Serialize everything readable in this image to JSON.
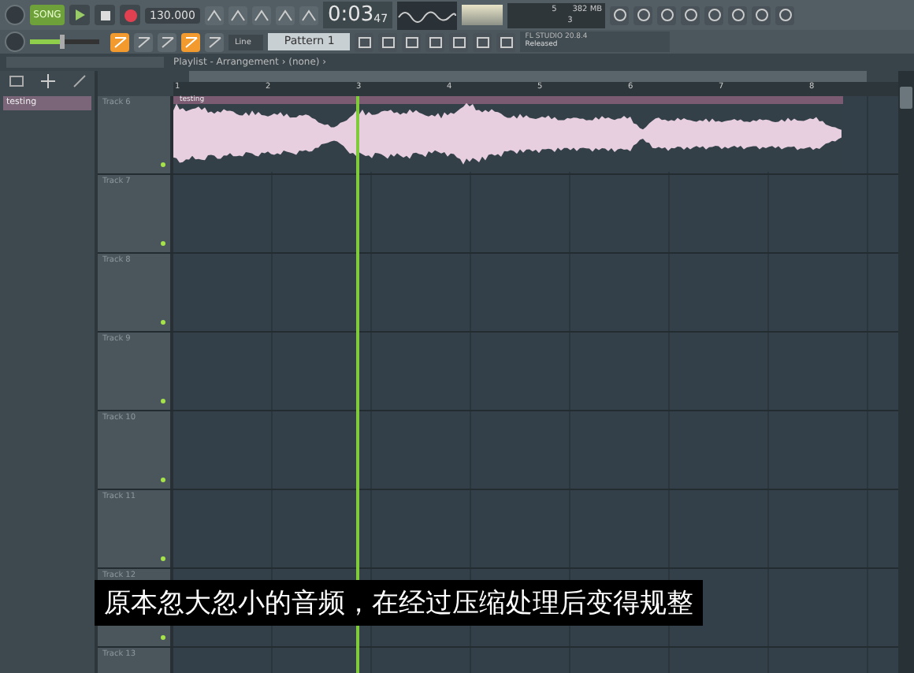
{
  "transport": {
    "mode": "SONG",
    "tempo": "130.000",
    "time": "0:03",
    "time_sub": "47"
  },
  "master_volume": {
    "level": 0.45
  },
  "snap": "Line",
  "pattern": "Pattern 1",
  "monitor": {
    "cpu": "5",
    "memory": "382 MB",
    "polyphony": "3"
  },
  "hint": {
    "title": "FL STUDIO 20.8.4",
    "text": "Released"
  },
  "tool_buttons": [
    {
      "selected": true
    },
    {
      "selected": false
    },
    {
      "selected": false
    },
    {
      "selected": true
    },
    {
      "selected": false
    }
  ],
  "playlist": {
    "title": "Playlist - Arrangement › (none) ›",
    "ruler": [
      "1",
      "2",
      "3",
      "4",
      "5",
      "6",
      "7",
      "8"
    ],
    "tracks": [
      {
        "name": "Track 6",
        "clip": "testing"
      },
      {
        "name": "Track 7"
      },
      {
        "name": "Track 8"
      },
      {
        "name": "Track 9"
      },
      {
        "name": "Track 10"
      },
      {
        "name": "Track 11"
      },
      {
        "name": "Track 12"
      },
      {
        "name": "Track 13"
      }
    ]
  },
  "browser": {
    "items": [
      {
        "label": "testing",
        "selected": true
      }
    ]
  },
  "subtitle": "原本忽大忽小的音频，在经过压缩处理后变得规整"
}
